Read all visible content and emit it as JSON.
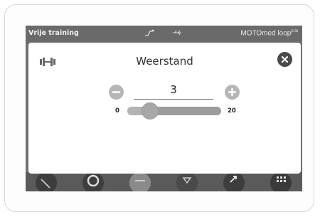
{
  "statusbar": {
    "mode_label": "Vrije training",
    "brand": "MOTOmed loop",
    "brand_suffix": "p.la"
  },
  "dialog": {
    "title": "Weerstand",
    "value": "3",
    "min_label": "0",
    "max_label": "20",
    "slider_fraction": 0.15
  },
  "bottombar": {
    "buttons": [
      "speed-icon",
      "stop-icon",
      "program-icon",
      "arrow-down-icon",
      "direction-icon",
      "menu-grid-icon"
    ]
  },
  "colors": {
    "screen_gray": "#6f6f6f",
    "button_gray": "#b6b6b6",
    "close_dark": "#4a4a4a"
  }
}
